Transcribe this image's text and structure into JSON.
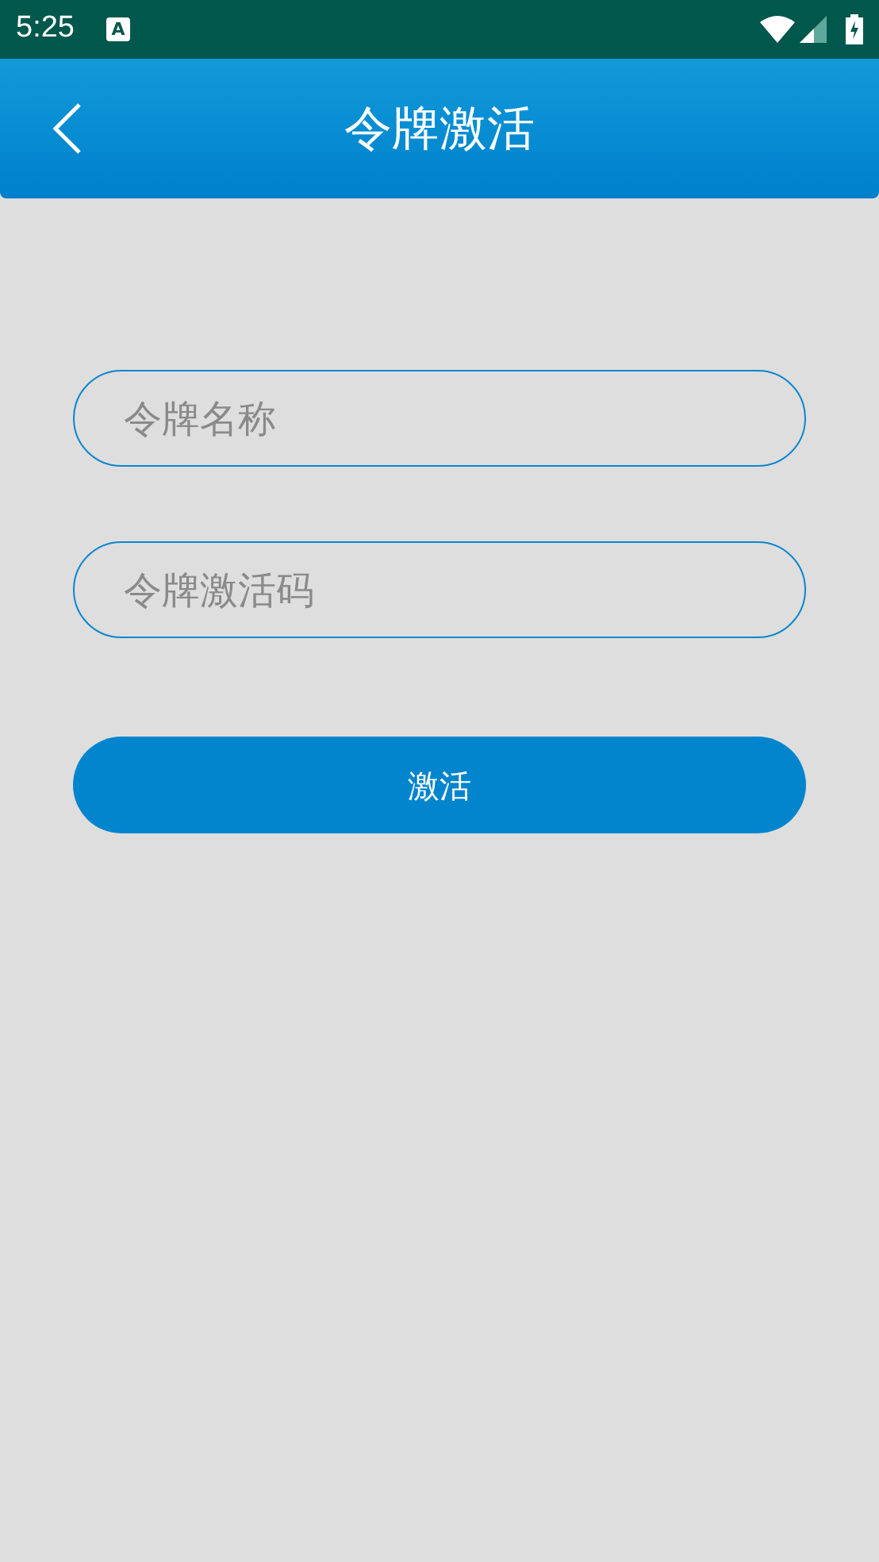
{
  "status_bar": {
    "time": "5:25",
    "notification_icon": "A"
  },
  "header": {
    "title": "令牌激活"
  },
  "form": {
    "fields": [
      {
        "placeholder": "令牌名称"
      },
      {
        "placeholder": "令牌激活码"
      }
    ],
    "submit": "激活"
  }
}
